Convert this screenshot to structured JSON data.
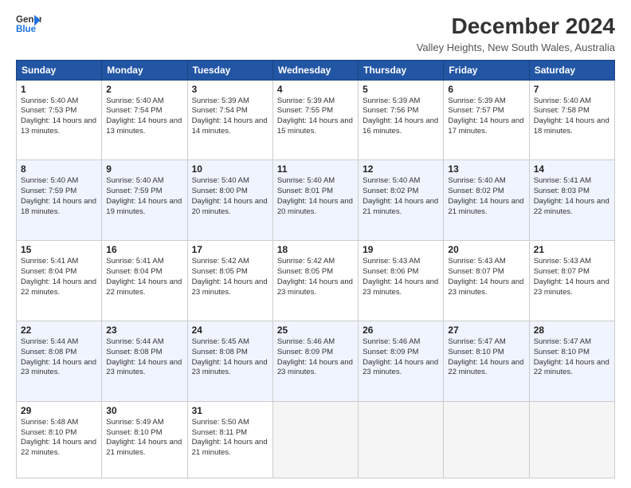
{
  "logo": {
    "line1": "General",
    "line2": "Blue"
  },
  "title": "December 2024",
  "subtitle": "Valley Heights, New South Wales, Australia",
  "days": [
    "Sunday",
    "Monday",
    "Tuesday",
    "Wednesday",
    "Thursday",
    "Friday",
    "Saturday"
  ],
  "weeks": [
    [
      {
        "date": "1",
        "sunrise": "5:40 AM",
        "sunset": "7:53 PM",
        "daylight": "14 hours and 13 minutes."
      },
      {
        "date": "2",
        "sunrise": "5:40 AM",
        "sunset": "7:54 PM",
        "daylight": "14 hours and 13 minutes."
      },
      {
        "date": "3",
        "sunrise": "5:39 AM",
        "sunset": "7:54 PM",
        "daylight": "14 hours and 14 minutes."
      },
      {
        "date": "4",
        "sunrise": "5:39 AM",
        "sunset": "7:55 PM",
        "daylight": "14 hours and 15 minutes."
      },
      {
        "date": "5",
        "sunrise": "5:39 AM",
        "sunset": "7:56 PM",
        "daylight": "14 hours and 16 minutes."
      },
      {
        "date": "6",
        "sunrise": "5:39 AM",
        "sunset": "7:57 PM",
        "daylight": "14 hours and 17 minutes."
      },
      {
        "date": "7",
        "sunrise": "5:40 AM",
        "sunset": "7:58 PM",
        "daylight": "14 hours and 18 minutes."
      }
    ],
    [
      {
        "date": "8",
        "sunrise": "5:40 AM",
        "sunset": "7:59 PM",
        "daylight": "14 hours and 18 minutes."
      },
      {
        "date": "9",
        "sunrise": "5:40 AM",
        "sunset": "7:59 PM",
        "daylight": "14 hours and 19 minutes."
      },
      {
        "date": "10",
        "sunrise": "5:40 AM",
        "sunset": "8:00 PM",
        "daylight": "14 hours and 20 minutes."
      },
      {
        "date": "11",
        "sunrise": "5:40 AM",
        "sunset": "8:01 PM",
        "daylight": "14 hours and 20 minutes."
      },
      {
        "date": "12",
        "sunrise": "5:40 AM",
        "sunset": "8:02 PM",
        "daylight": "14 hours and 21 minutes."
      },
      {
        "date": "13",
        "sunrise": "5:40 AM",
        "sunset": "8:02 PM",
        "daylight": "14 hours and 21 minutes."
      },
      {
        "date": "14",
        "sunrise": "5:41 AM",
        "sunset": "8:03 PM",
        "daylight": "14 hours and 22 minutes."
      }
    ],
    [
      {
        "date": "15",
        "sunrise": "5:41 AM",
        "sunset": "8:04 PM",
        "daylight": "14 hours and 22 minutes."
      },
      {
        "date": "16",
        "sunrise": "5:41 AM",
        "sunset": "8:04 PM",
        "daylight": "14 hours and 22 minutes."
      },
      {
        "date": "17",
        "sunrise": "5:42 AM",
        "sunset": "8:05 PM",
        "daylight": "14 hours and 23 minutes."
      },
      {
        "date": "18",
        "sunrise": "5:42 AM",
        "sunset": "8:05 PM",
        "daylight": "14 hours and 23 minutes."
      },
      {
        "date": "19",
        "sunrise": "5:43 AM",
        "sunset": "8:06 PM",
        "daylight": "14 hours and 23 minutes."
      },
      {
        "date": "20",
        "sunrise": "5:43 AM",
        "sunset": "8:07 PM",
        "daylight": "14 hours and 23 minutes."
      },
      {
        "date": "21",
        "sunrise": "5:43 AM",
        "sunset": "8:07 PM",
        "daylight": "14 hours and 23 minutes."
      }
    ],
    [
      {
        "date": "22",
        "sunrise": "5:44 AM",
        "sunset": "8:08 PM",
        "daylight": "14 hours and 23 minutes."
      },
      {
        "date": "23",
        "sunrise": "5:44 AM",
        "sunset": "8:08 PM",
        "daylight": "14 hours and 23 minutes."
      },
      {
        "date": "24",
        "sunrise": "5:45 AM",
        "sunset": "8:08 PM",
        "daylight": "14 hours and 23 minutes."
      },
      {
        "date": "25",
        "sunrise": "5:46 AM",
        "sunset": "8:09 PM",
        "daylight": "14 hours and 23 minutes."
      },
      {
        "date": "26",
        "sunrise": "5:46 AM",
        "sunset": "8:09 PM",
        "daylight": "14 hours and 23 minutes."
      },
      {
        "date": "27",
        "sunrise": "5:47 AM",
        "sunset": "8:10 PM",
        "daylight": "14 hours and 22 minutes."
      },
      {
        "date": "28",
        "sunrise": "5:47 AM",
        "sunset": "8:10 PM",
        "daylight": "14 hours and 22 minutes."
      }
    ],
    [
      {
        "date": "29",
        "sunrise": "5:48 AM",
        "sunset": "8:10 PM",
        "daylight": "14 hours and 22 minutes."
      },
      {
        "date": "30",
        "sunrise": "5:49 AM",
        "sunset": "8:10 PM",
        "daylight": "14 hours and 21 minutes."
      },
      {
        "date": "31",
        "sunrise": "5:50 AM",
        "sunset": "8:11 PM",
        "daylight": "14 hours and 21 minutes."
      },
      null,
      null,
      null,
      null
    ]
  ]
}
